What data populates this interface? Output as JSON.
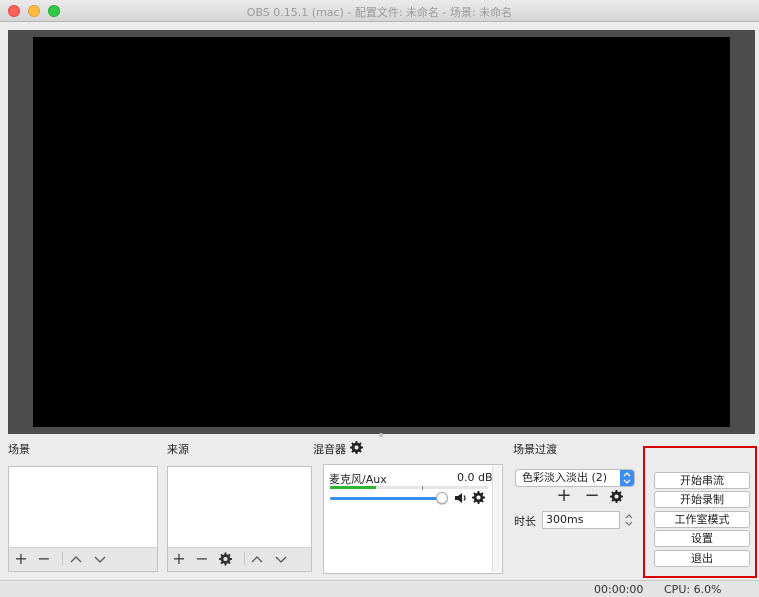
{
  "window": {
    "title": "OBS 0.15.1 (mac) - 配置文件: 未命名 - 场景: 未命名",
    "traffic_lights": {
      "close": "#fc605c",
      "minimize": "#fdbc40",
      "zoom": "#34c84a"
    }
  },
  "scenes": {
    "label": "场景",
    "toolbar": [
      "add-icon",
      "remove-icon",
      "move-up-icon",
      "move-down-icon"
    ]
  },
  "sources": {
    "label": "来源",
    "toolbar": [
      "add-icon",
      "remove-icon",
      "gear-icon",
      "move-up-icon",
      "move-down-icon"
    ]
  },
  "mixer": {
    "label": "混音器",
    "channels": [
      {
        "name": "麦克风/Aux",
        "db": "0.0 dB",
        "volume_fraction": 1.0
      }
    ]
  },
  "transitions": {
    "label": "场景过渡",
    "selected": "色彩淡入淡出 (2)",
    "duration_label": "时长",
    "duration_value": "300ms"
  },
  "controls": {
    "start_streaming": "开始串流",
    "start_recording": "开始录制",
    "studio_mode": "工作室模式",
    "settings": "设置",
    "exit": "退出"
  },
  "status": {
    "time": "00:00:00",
    "cpu": "CPU: 6.0%"
  },
  "colors": {
    "accent": "#3b8ef0",
    "highlight_border": "#d80000",
    "meter_green": "#2fb52f"
  }
}
